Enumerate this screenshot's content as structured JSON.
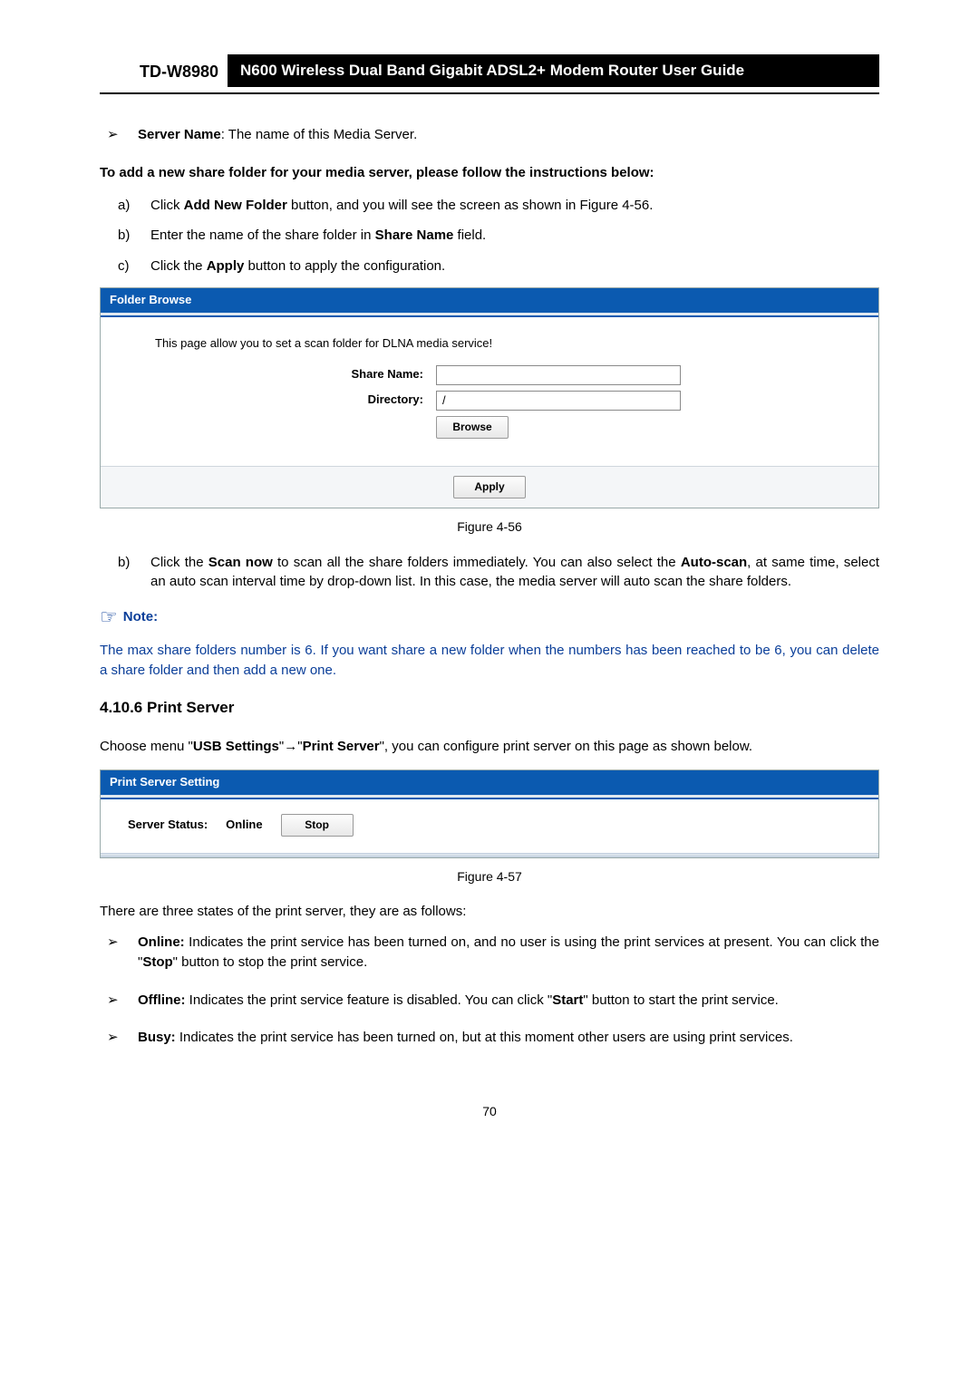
{
  "header": {
    "model": "TD-W8980",
    "desc": "N600 Wireless Dual Band Gigabit ADSL2+ Modem Router User Guide"
  },
  "server_name_bullet": {
    "label": "Server Name",
    "rest": ": The name of this Media Server."
  },
  "add_folder_heading": "To add a new share folder for your media server, please follow the instructions below:",
  "steps_abc": {
    "a_pre": "Click ",
    "a_bold": "Add New Folder",
    "a_post": " button, and you will see the screen as shown in Figure 4-56.",
    "b_pre": "Enter the name of the share folder in ",
    "b_bold": "Share Name",
    "b_post": " field.",
    "c_pre": "Click the ",
    "c_bold": "Apply",
    "c_post": " button to apply the configuration."
  },
  "fig1": {
    "title": "Folder Browse",
    "intro": "This page allow you to set a scan folder for DLNA media service!",
    "share_name_label": "Share Name:",
    "share_name_value": "",
    "directory_label": "Directory:",
    "directory_value": "/",
    "browse_btn": "Browse",
    "apply_btn": "Apply",
    "caption": "Figure 4-56"
  },
  "step_b2": {
    "pre": "Click the ",
    "bold1": "Scan now",
    "mid1": " to scan all the share folders immediately. You can also select the ",
    "bold2": "Auto-scan",
    "post": ", at same time, select an auto scan interval time by drop-down list. In this case, the media server will auto scan the share folders."
  },
  "note": {
    "label": "Note:",
    "body": "The max share folders number is 6. If you want share a new folder when the numbers has been reached to be 6, you can delete a share folder and then add a new one."
  },
  "section_heading": "4.10.6 Print Server",
  "print_intro": {
    "pre": "Choose menu \"",
    "bold1": "USB Settings",
    "mid": "\"→\"",
    "bold2": "Print Server",
    "post": "\", you can configure print server on this page as shown below."
  },
  "fig2": {
    "title": "Print Server Setting",
    "status_label": "Server Status:",
    "status_value": "Online",
    "stop_btn": "Stop",
    "caption": "Figure 4-57"
  },
  "states_intro": "There are three states of the print server, they are as follows:",
  "states": {
    "online_label": "Online:",
    "online_body_1": " Indicates the print service has been turned on, and no user is using the print services at present. You can click the \"",
    "online_bold_stop": "Stop",
    "online_body_2": "\" button to stop the print service.",
    "offline_label": "Offline:",
    "offline_body_1": " Indicates the print service feature is disabled. You can click \"",
    "offline_bold_start": "Start",
    "offline_body_2": "\" button to start the print service.",
    "busy_label": "Busy:",
    "busy_body": " Indicates the print service has been turned on, but at this moment other users are using print services."
  },
  "page_number": "70"
}
